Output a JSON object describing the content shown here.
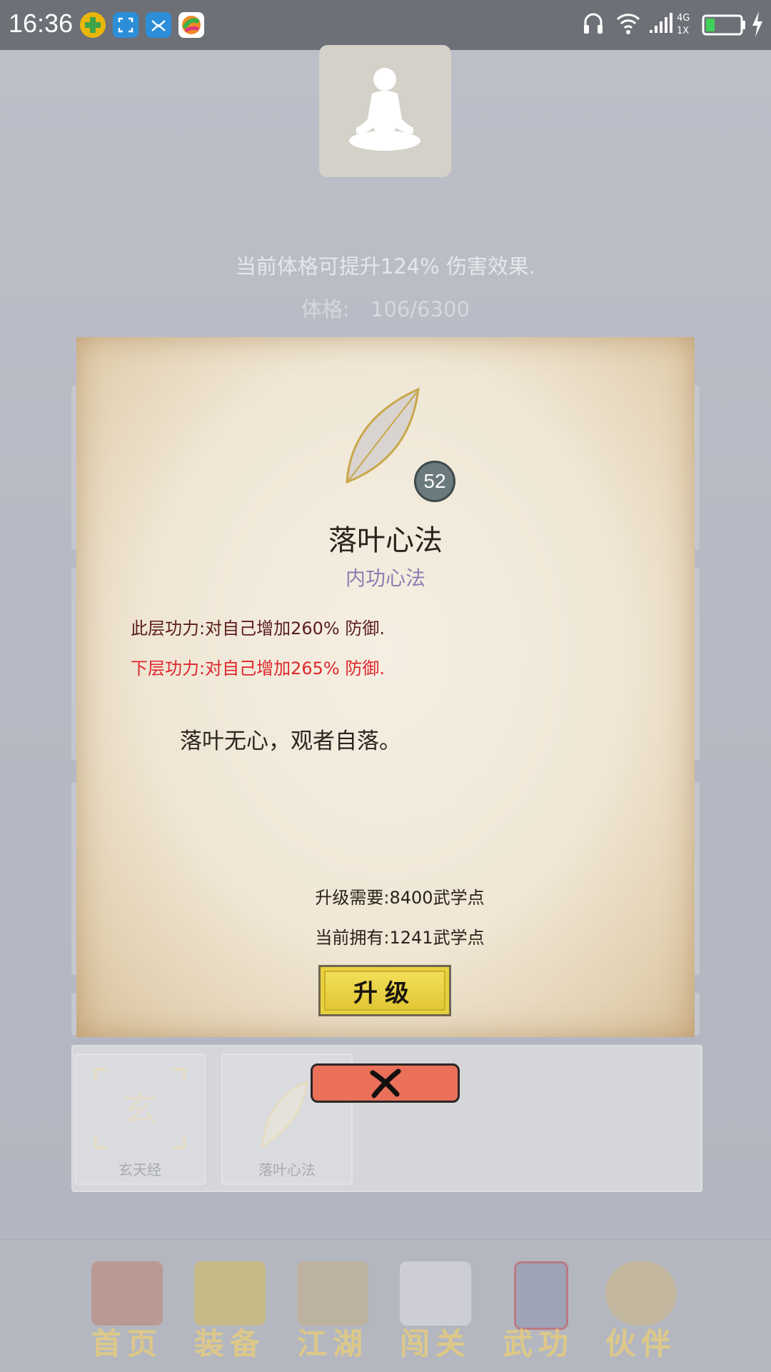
{
  "status_bar": {
    "time": "16:36",
    "network_top": "4G",
    "network_bottom": "1X",
    "battery_level": 0.25,
    "icons": [
      "app-plus-icon",
      "screenshot-icon",
      "transfer-icon",
      "game-center-icon",
      "headphones-icon",
      "wifi-icon",
      "signal-icon",
      "battery-icon",
      "charging-icon"
    ]
  },
  "cultivation": {
    "avatar_icon": "meditation-icon",
    "effect_text": "当前体格可提升124% 伤害效果.",
    "physique_label": "体格:",
    "physique_value": "106/6300"
  },
  "dialog": {
    "skill_icon": "leaf-icon",
    "level": "52",
    "title": "落叶心法",
    "subtitle": "内功心法",
    "current_effect": "此层功力:对自己增加260% 防御.",
    "next_effect": "下层功力:对自己增加265% 防御.",
    "quote": "落叶无心，观者自落。",
    "upgrade_cost": "升级需要:8400武学点",
    "owned_points": "当前拥有:1241武学点",
    "upgrade_label": "升级",
    "close_icon": "close-icon"
  },
  "skill_list": [
    {
      "label": "玄天经",
      "icon": "xuantian-icon"
    },
    {
      "label": "落叶心法",
      "icon": "leaf-icon"
    }
  ],
  "bottom_nav": [
    {
      "label": "首页",
      "icon": "home-icon"
    },
    {
      "label": "装备",
      "icon": "armor-icon"
    },
    {
      "label": "江湖",
      "icon": "scroll-map-icon"
    },
    {
      "label": "闯关",
      "icon": "crossed-swords-icon"
    },
    {
      "label": "武功",
      "icon": "martial-book-icon"
    },
    {
      "label": "伙伴",
      "icon": "partners-icon"
    }
  ],
  "colors": {
    "next_effect": "#e0262c",
    "subtitle": "#8b7fb3",
    "upgrade_button": "#e8cf3c",
    "close_button": "#ea705a"
  }
}
